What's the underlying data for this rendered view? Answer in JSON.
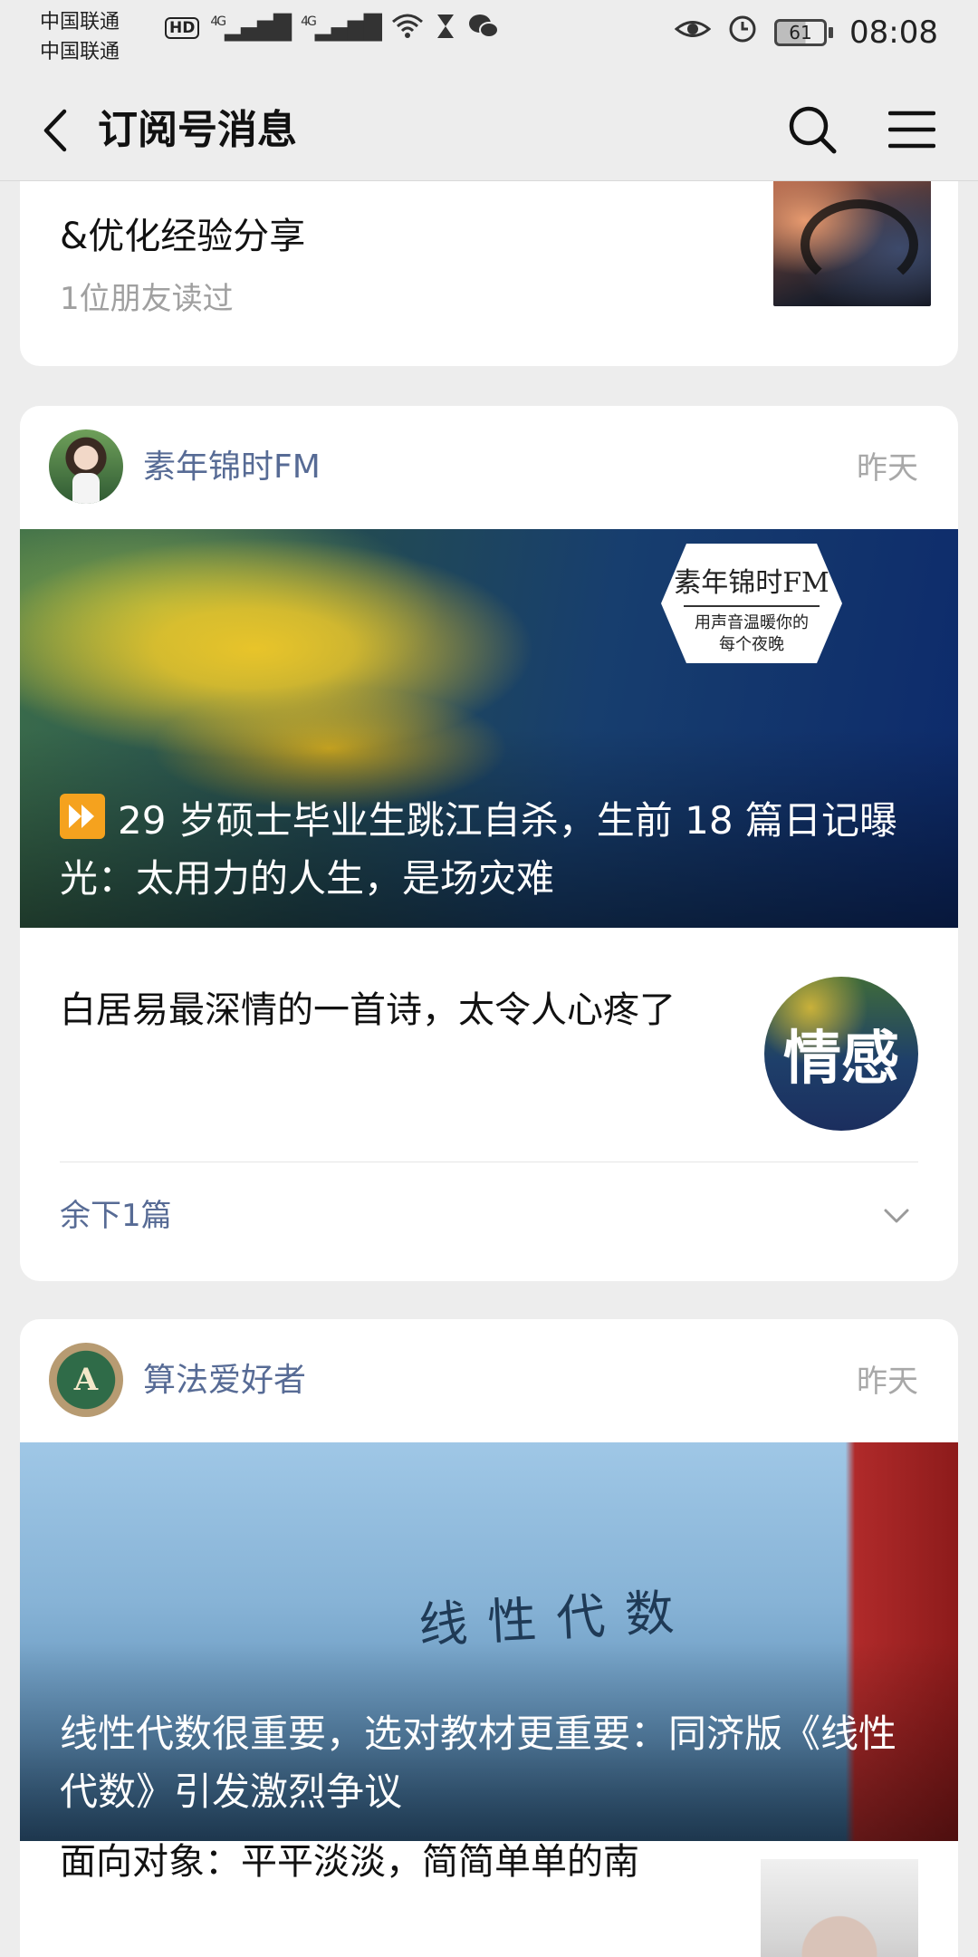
{
  "status_bar": {
    "carrier_1": "中国联通",
    "carrier_2": "中国联通",
    "hd_badge": "HD",
    "net_type_1": "4G",
    "net_type_2": "4G",
    "battery_level": "61",
    "time": "08:08"
  },
  "header": {
    "title": "订阅号消息"
  },
  "cards": [
    {
      "partial_title": "&优化经验分享",
      "read_count": "1位朋友读过"
    },
    {
      "account_name": "素年锦时FM",
      "time": "昨天",
      "hero_caption": "29 岁硕士毕业生跳江自杀，生前 18 篇日记曝光：太用力的人生，是场灾难",
      "hero_logo_line1": "素年锦时FM",
      "hero_logo_line2": "用声音温暖你的",
      "hero_logo_line3": "每个夜晚",
      "sub_article_title": "白居易最深情的一首诗，太令人心疼了",
      "sub_article_thumb_text": "情感",
      "more_label": "余下1篇"
    },
    {
      "account_name": "算法爱好者",
      "avatar_letter": "A",
      "time": "昨天",
      "hero_book_title": "线性代数",
      "hero_caption": "线性代数很重要，选对教材更重要：同济版《线性代数》引发激烈争议",
      "sub_article_title": "面向对象：平平淡淡，简简单单的南"
    }
  ],
  "colors": {
    "page_bg": "#ededed",
    "card_bg": "#ffffff",
    "link_blue": "#576b95",
    "meta_gray": "#a8a8a8"
  }
}
